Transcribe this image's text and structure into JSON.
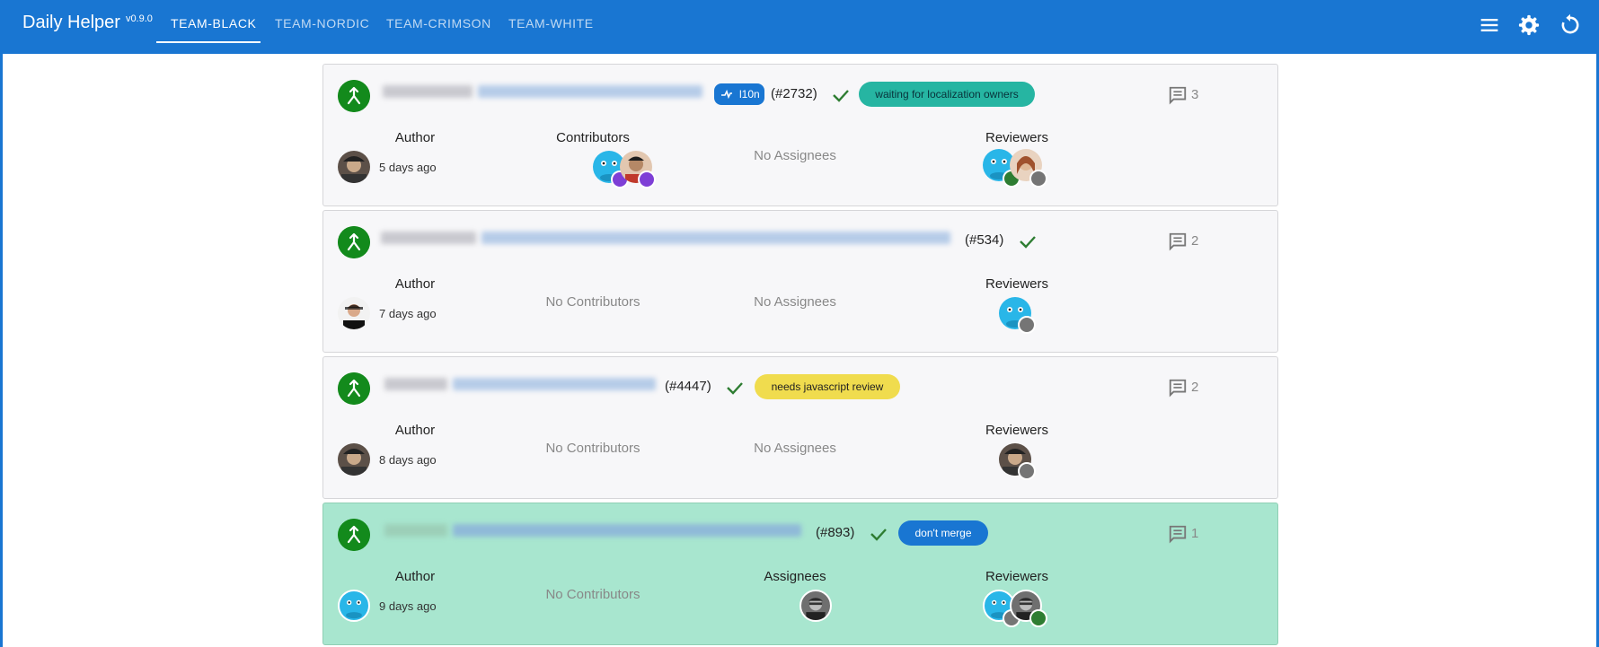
{
  "app": {
    "title": "Daily Helper",
    "version": "v0.9.0",
    "tabs": [
      {
        "label": "TEAM-BLACK",
        "active": true
      },
      {
        "label": "TEAM-NORDIC",
        "active": false
      },
      {
        "label": "TEAM-CRIMSON",
        "active": false
      },
      {
        "label": "TEAM-WHITE",
        "active": false
      }
    ],
    "icons": [
      "menu-icon",
      "settings-icon",
      "refresh-icon"
    ],
    "colors": {
      "appbar": "#1976d2",
      "card": "#f7f7f9",
      "highlight_card": "#a8e6cf",
      "merged": "#138a1c"
    }
  },
  "pull_requests": [
    {
      "number": "(#2732)",
      "chip": "l10n",
      "label": "waiting for localization owners",
      "label_color": "#26b5a2",
      "comments": "3",
      "author_heading": "Author",
      "age": "5 days ago",
      "contributors_heading": "Contributors",
      "assignees_text": "No Assignees",
      "reviewers_heading": "Reviewers"
    },
    {
      "number": "(#534)",
      "comments": "2",
      "author_heading": "Author",
      "age": "7 days ago",
      "contributors_text": "No Contributors",
      "assignees_text": "No Assignees",
      "reviewers_heading": "Reviewers"
    },
    {
      "number": "(#4447)",
      "label": "needs javascript review",
      "label_color": "#f0dc4e",
      "comments": "2",
      "author_heading": "Author",
      "age": "8 days ago",
      "contributors_text": "No Contributors",
      "assignees_text": "No Assignees",
      "reviewers_heading": "Reviewers"
    },
    {
      "number": "(#893)",
      "label": "don't merge",
      "label_color": "#1976d2",
      "comments": "1",
      "author_heading": "Author",
      "age": "9 days ago",
      "contributors_text": "No Contributors",
      "assignees_heading": "Assignees",
      "reviewers_heading": "Reviewers"
    }
  ]
}
